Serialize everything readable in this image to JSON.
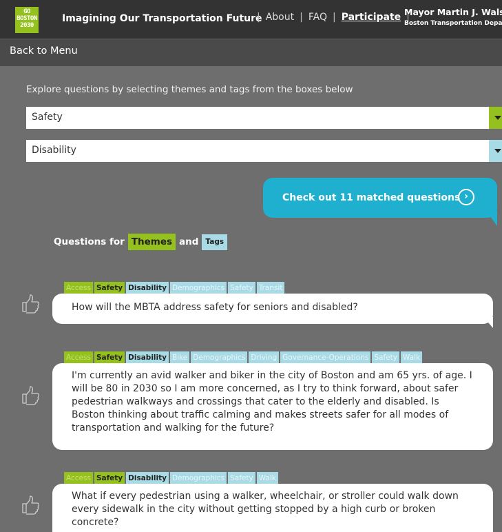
{
  "header": {
    "logo_lines": [
      "GO",
      "BOSTON",
      "2030"
    ],
    "title": "Imagining Our Transportation Future",
    "nav": [
      {
        "label": "About",
        "active": false
      },
      {
        "label": "FAQ",
        "active": false
      },
      {
        "label": "Participate",
        "active": true
      }
    ],
    "mayor_name": "Mayor Martin J. Walsh",
    "department": "Boston Transportation Departm"
  },
  "menu": {
    "back_label": "Back to Menu"
  },
  "filters": {
    "intro": "Explore questions by selecting themes and tags from the boxes below",
    "theme_select": {
      "value": "Safety",
      "accent": "#95c11f"
    },
    "tag_select": {
      "value": "Disability",
      "accent": "#a9dbe6"
    }
  },
  "match_button": {
    "label": "Check out 11 matched questions",
    "icon": "chevron-right-circle-icon",
    "color": "#1fb0d0"
  },
  "legend": {
    "prefix": "Questions for",
    "themes": "Themes",
    "and": "and",
    "tags": "Tags"
  },
  "questions": [
    {
      "tags": [
        {
          "label": "Access",
          "kind": "theme-off"
        },
        {
          "label": "Safety",
          "kind": "theme-on"
        },
        {
          "label": "Disability",
          "kind": "tag-on"
        },
        {
          "label": "Demographics",
          "kind": "tag-off"
        },
        {
          "label": "Safety",
          "kind": "tag-off"
        },
        {
          "label": "Transit",
          "kind": "tag-off"
        }
      ],
      "text": "How will the MBTA address safety for seniors and disabled?",
      "icon": "thumbs-up-icon"
    },
    {
      "tags": [
        {
          "label": "Access",
          "kind": "theme-off"
        },
        {
          "label": "Safety",
          "kind": "theme-on"
        },
        {
          "label": "Disability",
          "kind": "tag-on"
        },
        {
          "label": "Bike",
          "kind": "tag-off"
        },
        {
          "label": "Demographics",
          "kind": "tag-off"
        },
        {
          "label": "Driving",
          "kind": "tag-off"
        },
        {
          "label": "Governance-Operations",
          "kind": "tag-off"
        },
        {
          "label": "Safety",
          "kind": "tag-off"
        },
        {
          "label": "Walk",
          "kind": "tag-off"
        }
      ],
      "text": "I'm currently an avid walker and biker in the city of Boston and am 65 yrs. of age. I will be 80 in 2030 so I am more concerned, as I try to think forward, about safer pedestrian walkways and crossings that cater to the elderly and disabled. Is Boston thinking about traffic calming and makes streets safer for all modes of transportation and walking for the future?",
      "icon": "thumbs-up-icon"
    },
    {
      "tags": [
        {
          "label": "Access",
          "kind": "theme-off"
        },
        {
          "label": "Safety",
          "kind": "theme-on"
        },
        {
          "label": "Disability",
          "kind": "tag-on"
        },
        {
          "label": "Demographics",
          "kind": "tag-off"
        },
        {
          "label": "Safety",
          "kind": "tag-off"
        },
        {
          "label": "Walk",
          "kind": "tag-off"
        }
      ],
      "text": "What if every pedestrian using a walker, wheelchair, or stroller could walk down every sidewalk in the city without getting stopped by a high curb or broken concrete?",
      "icon": "thumbs-up-icon"
    }
  ]
}
